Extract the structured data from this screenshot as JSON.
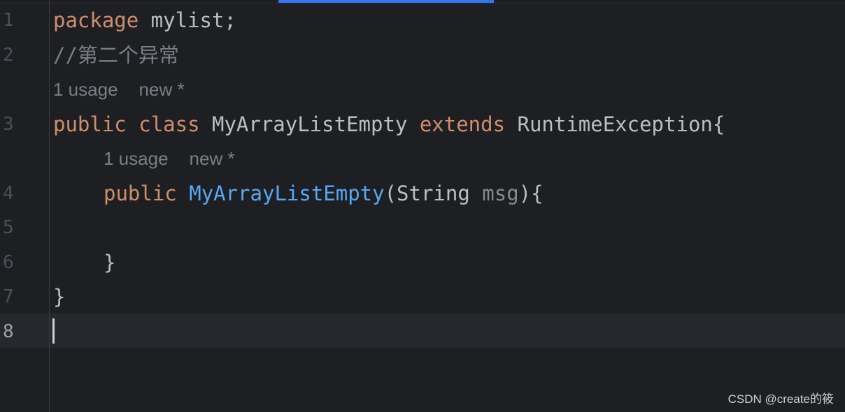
{
  "editor": {
    "line_numbers": [
      "1",
      "2",
      "3",
      "4",
      "5",
      "6",
      "7",
      "8"
    ],
    "lines": {
      "l1": {
        "kw": "package",
        "rest": " mylist;"
      },
      "l2": {
        "comment": "//第二个异常"
      },
      "l3": {
        "kw1": "public",
        "kw2": "class",
        "name": " MyArrayListEmpty ",
        "kw3": "extends",
        "rest": " RuntimeException{"
      },
      "l4": {
        "kw": "public",
        "fn": "MyArrayListEmpty",
        "open": "(String ",
        "param": "msg",
        "close": "){"
      },
      "l6": {
        "text": "}"
      },
      "l7": {
        "text": "}"
      }
    },
    "inlay_hints": [
      {
        "usage": "1 usage",
        "author": "new *"
      },
      {
        "usage": "1 usage",
        "author": "new *"
      }
    ],
    "active_line": "8"
  },
  "colors": {
    "background": "#1e1f22",
    "keyword": "#cf8e6d",
    "function": "#56a8f5",
    "comment": "#7a7e85",
    "text": "#bcbec4",
    "tab_accent": "#3574f0"
  },
  "watermark": "CSDN @create的筱"
}
